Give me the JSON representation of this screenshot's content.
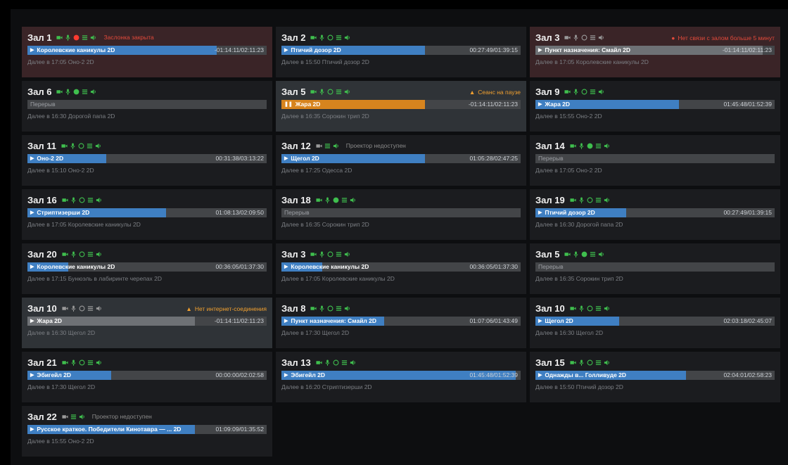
{
  "colors": {
    "accent": "#3f7fc2",
    "ok": "#3fbf4e",
    "warning": "#f0a030",
    "error": "#e24a3b"
  },
  "halls": [
    {
      "name": "Зал 1",
      "alert": true,
      "icons": [
        "camera",
        "mic",
        "red-dot",
        "menu",
        "speaker"
      ],
      "note": "Заслонка закрыта",
      "note_color": "red",
      "status": "",
      "movie": "Королевские каникулы 2D",
      "progress": 0.79,
      "time": "-01:14:11/02:11:23",
      "next": "Далее в 17:05 Оно-2 2D"
    },
    {
      "name": "Зал 2",
      "icons": [
        "camera",
        "mic",
        "ring",
        "menu",
        "speaker"
      ],
      "note": "",
      "status": "",
      "movie": "Птичий дозор 2D",
      "progress": 0.6,
      "time": "00:27:49/01:39:15",
      "next": "Далее в 15:50 Птичий дозор 2D"
    },
    {
      "name": "Зал 3",
      "alert": true,
      "icons": [
        "camera-grey",
        "mic-grey",
        "ring-grey",
        "menu-grey",
        "speaker-grey"
      ],
      "note": "",
      "status": "Нет связи с залом больше 5 минут",
      "status_color": "red",
      "status_icon": "error-icon",
      "movie": "Пункт назначения: Смайл 2D",
      "progress": 0.95,
      "fill": "gray",
      "time": "-01:14:11/02:11:23",
      "next": "Далее в 17:05 Королевские каникулы 2D"
    },
    {
      "name": "Зал 6",
      "icons": [
        "camera",
        "mic",
        "dot",
        "menu",
        "speaker"
      ],
      "note": "",
      "status": "",
      "break": true,
      "movie": "Перерыв",
      "time": "",
      "next": "Далее в 16:30 Дорогой папа 2D"
    },
    {
      "name": "Зал 5",
      "warn": true,
      "icons": [
        "camera",
        "mic",
        "ring",
        "menu",
        "speaker"
      ],
      "note": "",
      "status": "Сеанс на паузе",
      "status_color": "orange",
      "status_icon": "warning-icon",
      "paused": true,
      "movie": "Жара 2D",
      "progress": 0.6,
      "fill": "orange",
      "time": "-01:14:11/02:11:23",
      "next": "Далее в 16:35 Сорокин трип 2D"
    },
    {
      "name": "Зал 9",
      "icons": [
        "camera",
        "mic",
        "ring",
        "menu",
        "speaker"
      ],
      "note": "",
      "status": "",
      "movie": "Жара 2D",
      "progress": 0.6,
      "time": "01:45:48/01:52:39",
      "next": "Далее в 15:55 Оно-2 2D"
    },
    {
      "name": "Зал 11",
      "icons": [
        "camera",
        "mic",
        "ring",
        "menu",
        "speaker"
      ],
      "note": "",
      "status": "",
      "movie": "Оно-2 2D",
      "progress": 0.33,
      "time": "00:31:38/03:13:22",
      "next": "Далее в 15:10 Оно-2 2D"
    },
    {
      "name": "Зал 12",
      "icons": [
        "camera-grey",
        "menu",
        "speaker"
      ],
      "note": "Проектор недоступен",
      "note_color": "grey",
      "status": "",
      "movie": "Щегол 2D",
      "progress": 0.6,
      "time": "01:05:28/02:47:25",
      "next": "Далее в 17:25 Одесса 2D"
    },
    {
      "name": "Зал 14",
      "icons": [
        "camera",
        "mic",
        "dot",
        "menu",
        "speaker"
      ],
      "note": "",
      "status": "",
      "break": true,
      "movie": "Перерыв",
      "time": "",
      "next": "Далее в 17:05 Оно-2 2D"
    },
    {
      "name": "Зал 16",
      "icons": [
        "camera",
        "mic",
        "ring",
        "menu",
        "speaker"
      ],
      "note": "",
      "status": "",
      "movie": "Стриптизерши 2D",
      "progress": 0.58,
      "time": "01:08:13/02:09:50",
      "next": "Далее в 17:05 Королевские каникулы 2D"
    },
    {
      "name": "Зал 18",
      "icons": [
        "camera",
        "mic",
        "dot",
        "menu",
        "speaker"
      ],
      "note": "",
      "status": "",
      "break": true,
      "movie": "Перерыв",
      "time": "",
      "next": "Далее в 16:35 Сорокин трип 2D"
    },
    {
      "name": "Зал 19",
      "icons": [
        "camera",
        "mic",
        "ring",
        "menu",
        "speaker"
      ],
      "note": "",
      "status": "",
      "movie": "Птичий дозор 2D",
      "progress": 0.38,
      "time": "00:27:49/01:39:15",
      "next": "Далее в 16:30 Дорогой папа 2D"
    },
    {
      "name": "Зал 20",
      "icons": [
        "camera",
        "mic",
        "ring",
        "menu",
        "speaker"
      ],
      "note": "",
      "status": "",
      "movie": "Королевские каникулы 2D",
      "progress": 0.17,
      "time": "00:36:05/01:37:30",
      "next": "Далее в 17:15 Бунюэль в лабиринте черепах 2D"
    },
    {
      "name": "Зал 3",
      "icons": [
        "camera",
        "mic",
        "ring",
        "menu",
        "speaker"
      ],
      "note": "",
      "status": "",
      "movie": "Королевские каникулы 2D",
      "progress": 0.17,
      "time": "00:36:05/01:37:30",
      "next": "Далее в 17:05 Королевские каникулы 2D"
    },
    {
      "name": "Зал 5",
      "icons": [
        "camera",
        "mic",
        "dot",
        "menu",
        "speaker"
      ],
      "note": "",
      "status": "",
      "break": true,
      "movie": "Перерыв",
      "time": "",
      "next": "Далее в 16:35 Сорокин трип 2D"
    },
    {
      "name": "Зал 10",
      "warn": true,
      "icons": [
        "camera-grey",
        "mic-grey",
        "ring-grey",
        "menu-grey",
        "speaker-grey"
      ],
      "note": "",
      "status": "Нет интернет-соединения",
      "status_color": "orange",
      "status_icon": "warning-icon",
      "movie": "Жара 2D",
      "progress": 0.7,
      "fill": "gray",
      "time": "-01:14:11/02:11:23",
      "next": "Далее в 16:30 Щегол 2D"
    },
    {
      "name": "Зал 8",
      "icons": [
        "camera",
        "mic",
        "ring",
        "menu",
        "speaker"
      ],
      "note": "",
      "status": "",
      "movie": "Пункт назначения: Смайл 2D",
      "progress": 0.43,
      "time": "01:07:06/01:43:49",
      "next": "Далее в 17:30 Щегол 2D"
    },
    {
      "name": "Зал 10",
      "icons": [
        "camera",
        "mic",
        "ring",
        "menu",
        "speaker"
      ],
      "note": "",
      "status": "",
      "movie": "Щегол 2D",
      "progress": 0.35,
      "time": "02:03:18/02:45:07",
      "next": "Далее в 16:30 Щегол 2D"
    },
    {
      "name": "Зал 21",
      "icons": [
        "camera",
        "mic",
        "ring",
        "menu",
        "speaker"
      ],
      "note": "",
      "status": "",
      "movie": "Эбигейл 2D",
      "progress": 0.35,
      "time": "00:00:00/02:02:58",
      "next": "Далее в 17:30 Щегол 2D"
    },
    {
      "name": "Зал 13",
      "icons": [
        "camera",
        "mic",
        "ring",
        "menu",
        "speaker"
      ],
      "note": "",
      "status": "",
      "movie": "Эбигейл 2D",
      "progress": 0.98,
      "time": "01:45:48/01:52:39",
      "next": "Далее в 16:20 Стриптизерши 2D"
    },
    {
      "name": "Зал 15",
      "icons": [
        "camera",
        "mic",
        "ring",
        "menu",
        "speaker"
      ],
      "note": "",
      "status": "",
      "movie": "Однажды в... Голливуде 2D",
      "progress": 0.63,
      "time": "02:04:01/02:58:23",
      "next": "Далее в 15:50 Птичий дозор 2D"
    },
    {
      "name": "Зал 22",
      "icons": [
        "camera-grey",
        "menu",
        "speaker"
      ],
      "note": "Проектор недоступен",
      "note_color": "grey",
      "status": "",
      "movie": "Русское краткое. Победители Кинотавра — ... 2D",
      "progress": 0.7,
      "time": "01:09:09/01:35:52",
      "next": "Далее в 15:55 Оно-2 2D"
    }
  ]
}
